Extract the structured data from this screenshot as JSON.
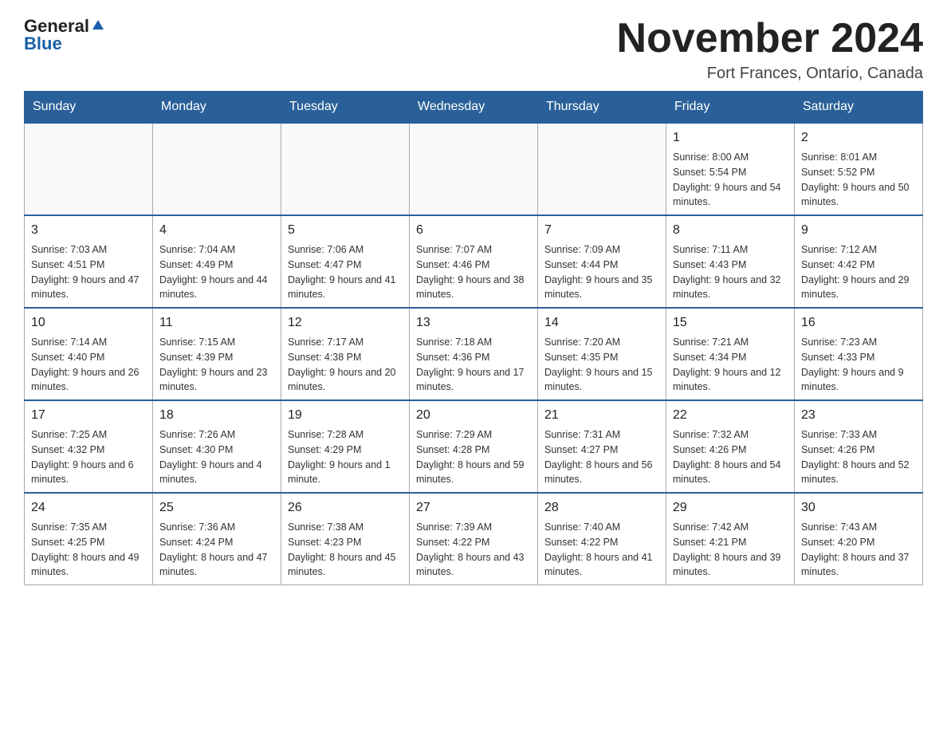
{
  "logo": {
    "general": "General",
    "blue": "Blue"
  },
  "header": {
    "title": "November 2024",
    "location": "Fort Frances, Ontario, Canada"
  },
  "days_of_week": [
    "Sunday",
    "Monday",
    "Tuesday",
    "Wednesday",
    "Thursday",
    "Friday",
    "Saturday"
  ],
  "weeks": [
    {
      "cells": [
        {
          "day": "",
          "empty": true
        },
        {
          "day": "",
          "empty": true
        },
        {
          "day": "",
          "empty": true
        },
        {
          "day": "",
          "empty": true
        },
        {
          "day": "",
          "empty": true
        },
        {
          "day": "1",
          "sunrise": "Sunrise: 8:00 AM",
          "sunset": "Sunset: 5:54 PM",
          "daylight": "Daylight: 9 hours and 54 minutes."
        },
        {
          "day": "2",
          "sunrise": "Sunrise: 8:01 AM",
          "sunset": "Sunset: 5:52 PM",
          "daylight": "Daylight: 9 hours and 50 minutes."
        }
      ]
    },
    {
      "cells": [
        {
          "day": "3",
          "sunrise": "Sunrise: 7:03 AM",
          "sunset": "Sunset: 4:51 PM",
          "daylight": "Daylight: 9 hours and 47 minutes."
        },
        {
          "day": "4",
          "sunrise": "Sunrise: 7:04 AM",
          "sunset": "Sunset: 4:49 PM",
          "daylight": "Daylight: 9 hours and 44 minutes."
        },
        {
          "day": "5",
          "sunrise": "Sunrise: 7:06 AM",
          "sunset": "Sunset: 4:47 PM",
          "daylight": "Daylight: 9 hours and 41 minutes."
        },
        {
          "day": "6",
          "sunrise": "Sunrise: 7:07 AM",
          "sunset": "Sunset: 4:46 PM",
          "daylight": "Daylight: 9 hours and 38 minutes."
        },
        {
          "day": "7",
          "sunrise": "Sunrise: 7:09 AM",
          "sunset": "Sunset: 4:44 PM",
          "daylight": "Daylight: 9 hours and 35 minutes."
        },
        {
          "day": "8",
          "sunrise": "Sunrise: 7:11 AM",
          "sunset": "Sunset: 4:43 PM",
          "daylight": "Daylight: 9 hours and 32 minutes."
        },
        {
          "day": "9",
          "sunrise": "Sunrise: 7:12 AM",
          "sunset": "Sunset: 4:42 PM",
          "daylight": "Daylight: 9 hours and 29 minutes."
        }
      ]
    },
    {
      "cells": [
        {
          "day": "10",
          "sunrise": "Sunrise: 7:14 AM",
          "sunset": "Sunset: 4:40 PM",
          "daylight": "Daylight: 9 hours and 26 minutes."
        },
        {
          "day": "11",
          "sunrise": "Sunrise: 7:15 AM",
          "sunset": "Sunset: 4:39 PM",
          "daylight": "Daylight: 9 hours and 23 minutes."
        },
        {
          "day": "12",
          "sunrise": "Sunrise: 7:17 AM",
          "sunset": "Sunset: 4:38 PM",
          "daylight": "Daylight: 9 hours and 20 minutes."
        },
        {
          "day": "13",
          "sunrise": "Sunrise: 7:18 AM",
          "sunset": "Sunset: 4:36 PM",
          "daylight": "Daylight: 9 hours and 17 minutes."
        },
        {
          "day": "14",
          "sunrise": "Sunrise: 7:20 AM",
          "sunset": "Sunset: 4:35 PM",
          "daylight": "Daylight: 9 hours and 15 minutes."
        },
        {
          "day": "15",
          "sunrise": "Sunrise: 7:21 AM",
          "sunset": "Sunset: 4:34 PM",
          "daylight": "Daylight: 9 hours and 12 minutes."
        },
        {
          "day": "16",
          "sunrise": "Sunrise: 7:23 AM",
          "sunset": "Sunset: 4:33 PM",
          "daylight": "Daylight: 9 hours and 9 minutes."
        }
      ]
    },
    {
      "cells": [
        {
          "day": "17",
          "sunrise": "Sunrise: 7:25 AM",
          "sunset": "Sunset: 4:32 PM",
          "daylight": "Daylight: 9 hours and 6 minutes."
        },
        {
          "day": "18",
          "sunrise": "Sunrise: 7:26 AM",
          "sunset": "Sunset: 4:30 PM",
          "daylight": "Daylight: 9 hours and 4 minutes."
        },
        {
          "day": "19",
          "sunrise": "Sunrise: 7:28 AM",
          "sunset": "Sunset: 4:29 PM",
          "daylight": "Daylight: 9 hours and 1 minute."
        },
        {
          "day": "20",
          "sunrise": "Sunrise: 7:29 AM",
          "sunset": "Sunset: 4:28 PM",
          "daylight": "Daylight: 8 hours and 59 minutes."
        },
        {
          "day": "21",
          "sunrise": "Sunrise: 7:31 AM",
          "sunset": "Sunset: 4:27 PM",
          "daylight": "Daylight: 8 hours and 56 minutes."
        },
        {
          "day": "22",
          "sunrise": "Sunrise: 7:32 AM",
          "sunset": "Sunset: 4:26 PM",
          "daylight": "Daylight: 8 hours and 54 minutes."
        },
        {
          "day": "23",
          "sunrise": "Sunrise: 7:33 AM",
          "sunset": "Sunset: 4:26 PM",
          "daylight": "Daylight: 8 hours and 52 minutes."
        }
      ]
    },
    {
      "cells": [
        {
          "day": "24",
          "sunrise": "Sunrise: 7:35 AM",
          "sunset": "Sunset: 4:25 PM",
          "daylight": "Daylight: 8 hours and 49 minutes."
        },
        {
          "day": "25",
          "sunrise": "Sunrise: 7:36 AM",
          "sunset": "Sunset: 4:24 PM",
          "daylight": "Daylight: 8 hours and 47 minutes."
        },
        {
          "day": "26",
          "sunrise": "Sunrise: 7:38 AM",
          "sunset": "Sunset: 4:23 PM",
          "daylight": "Daylight: 8 hours and 45 minutes."
        },
        {
          "day": "27",
          "sunrise": "Sunrise: 7:39 AM",
          "sunset": "Sunset: 4:22 PM",
          "daylight": "Daylight: 8 hours and 43 minutes."
        },
        {
          "day": "28",
          "sunrise": "Sunrise: 7:40 AM",
          "sunset": "Sunset: 4:22 PM",
          "daylight": "Daylight: 8 hours and 41 minutes."
        },
        {
          "day": "29",
          "sunrise": "Sunrise: 7:42 AM",
          "sunset": "Sunset: 4:21 PM",
          "daylight": "Daylight: 8 hours and 39 minutes."
        },
        {
          "day": "30",
          "sunrise": "Sunrise: 7:43 AM",
          "sunset": "Sunset: 4:20 PM",
          "daylight": "Daylight: 8 hours and 37 minutes."
        }
      ]
    }
  ]
}
